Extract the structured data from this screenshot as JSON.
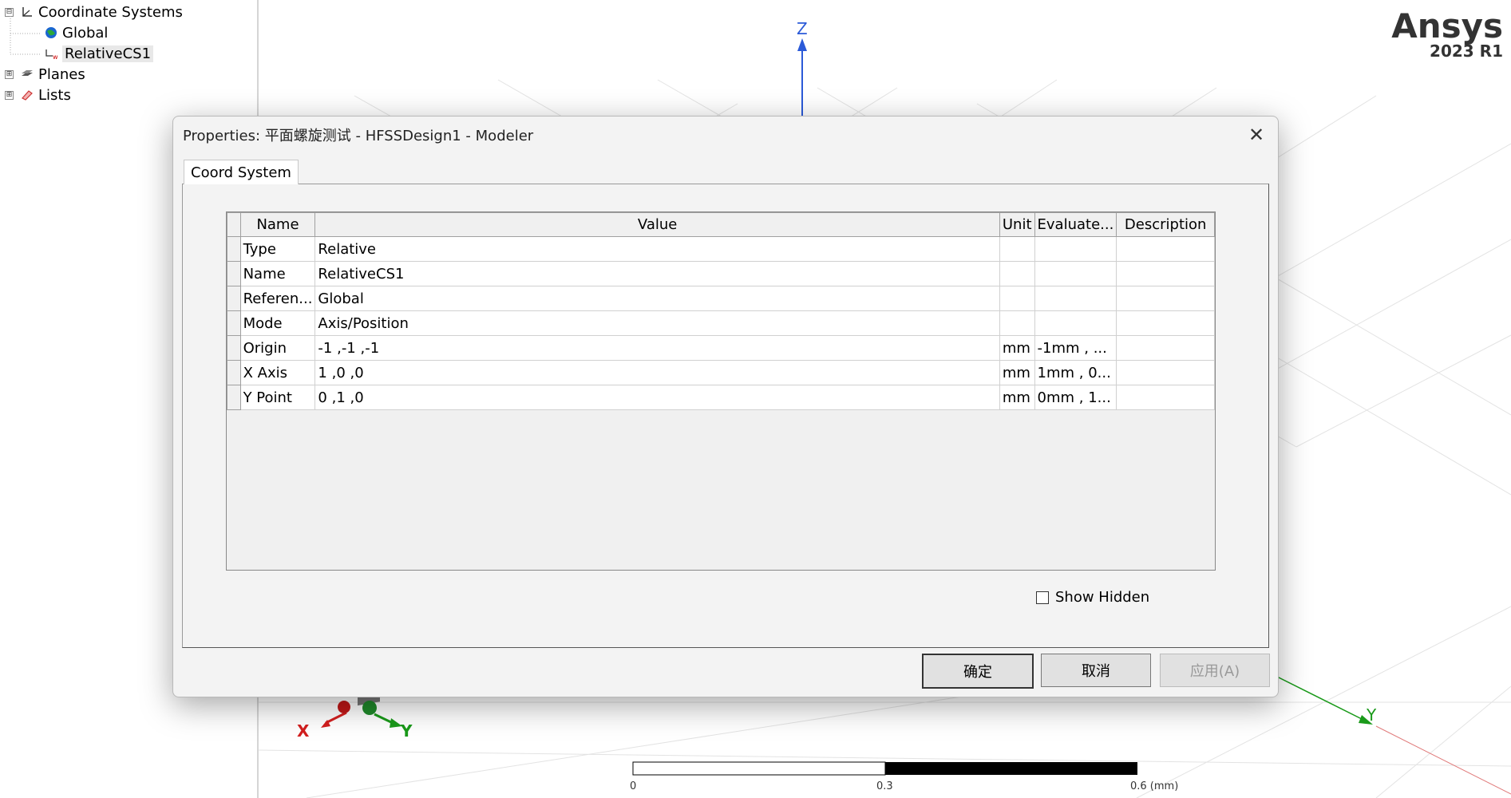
{
  "tree": {
    "items": [
      {
        "label": "Coordinate Systems",
        "icon": "axes-icon",
        "expander": "⊟"
      },
      {
        "label": "Global",
        "icon": "globe-icon"
      },
      {
        "label": "RelativeCS1",
        "icon": "relative-cs-icon"
      },
      {
        "label": "Planes",
        "icon": "planes-icon",
        "expander": "⊞"
      },
      {
        "label": "Lists",
        "icon": "lists-icon",
        "expander": "⊞"
      }
    ]
  },
  "viewport": {
    "brand": "Ansys",
    "version": "2023 R1",
    "axis_z": "Z",
    "axis_x": "X",
    "axis_y": "Y",
    "axis_y_far": "Y",
    "scale_labels": [
      "0",
      "0.3",
      "0.6 (mm)"
    ]
  },
  "dialog": {
    "title": "Properties: 平面螺旋测试 - HFSSDesign1 - Modeler",
    "close_icon": "close-icon",
    "tab": "Coord System",
    "columns": [
      "Name",
      "Value",
      "Unit",
      "Evaluate...",
      "Description"
    ],
    "rows": [
      {
        "name": "Type",
        "value": "Relative",
        "unit": "",
        "evaluated": "",
        "description": ""
      },
      {
        "name": "Name",
        "value": "RelativeCS1",
        "unit": "",
        "evaluated": "",
        "description": ""
      },
      {
        "name": "Referen...",
        "value": "Global",
        "unit": "",
        "evaluated": "",
        "description": ""
      },
      {
        "name": "Mode",
        "value": "Axis/Position",
        "unit": "",
        "evaluated": "",
        "description": ""
      },
      {
        "name": "Origin",
        "value": "-1 ,-1 ,-1",
        "unit": "mm",
        "evaluated": "-1mm , ...",
        "description": ""
      },
      {
        "name": "X Axis",
        "value": "1 ,0 ,0",
        "unit": "mm",
        "evaluated": "1mm , 0...",
        "description": ""
      },
      {
        "name": "Y Point",
        "value": "0 ,1 ,0",
        "unit": "mm",
        "evaluated": "0mm , 1...",
        "description": ""
      }
    ],
    "show_hidden_label": "Show Hidden",
    "show_hidden_checked": false,
    "ok_label": "确定",
    "cancel_label": "取消",
    "apply_label": "应用(A)"
  }
}
